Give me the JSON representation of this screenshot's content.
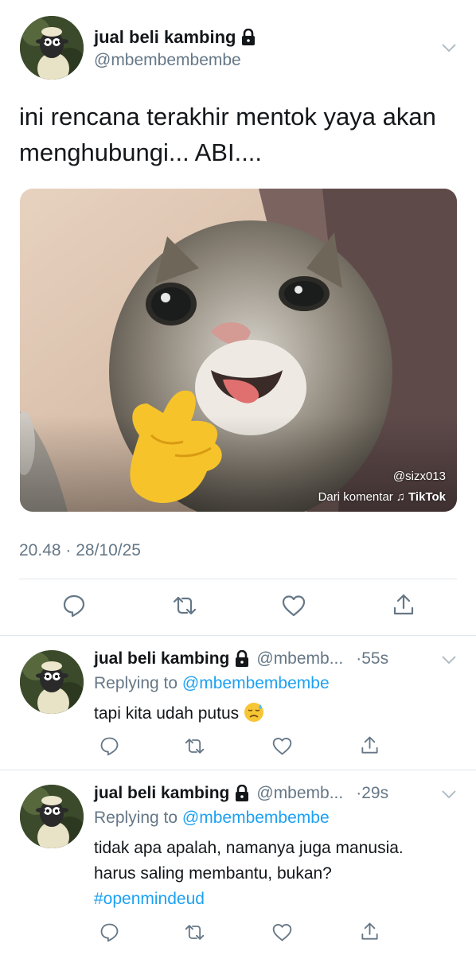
{
  "main_tweet": {
    "display_name": "jual beli kambing",
    "handle": "@mbembembembe",
    "text_line1": "ini rencana terakhir mentok yaya akan",
    "text_line2": "menghubungi... ABI....",
    "media": {
      "watermark_user": "@sizx013",
      "watermark_source": "Dari komentar",
      "watermark_brand": "TikTok"
    },
    "timestamp": "20.48 · 28/10/25",
    "actions": [
      "reply-icon",
      "retweet-icon",
      "like-icon",
      "share-icon"
    ]
  },
  "replies": [
    {
      "display_name": "jual beli kambing",
      "handle_truncated": "@mbemb...",
      "time": "·55s",
      "replying_prefix": "Replying to",
      "replying_to": "@mbembembembe",
      "text": "tapi kita udah putus",
      "emoji": "downcast-face-with-sweat-emoji"
    },
    {
      "display_name": "jual beli kambing",
      "handle_truncated": "@mbemb...",
      "time": "·29s",
      "replying_prefix": "Replying to",
      "replying_to": "@mbembembembe",
      "text_line1": "tidak apa apalah, namanya juga manusia.",
      "text_line2": "harus saling membantu, bukan?",
      "hashtag": "#openmindeud"
    }
  ],
  "colors": {
    "link": "#1da1f2",
    "secondary": "#657786",
    "divider": "#e1e8ed",
    "icon": "#657786"
  }
}
